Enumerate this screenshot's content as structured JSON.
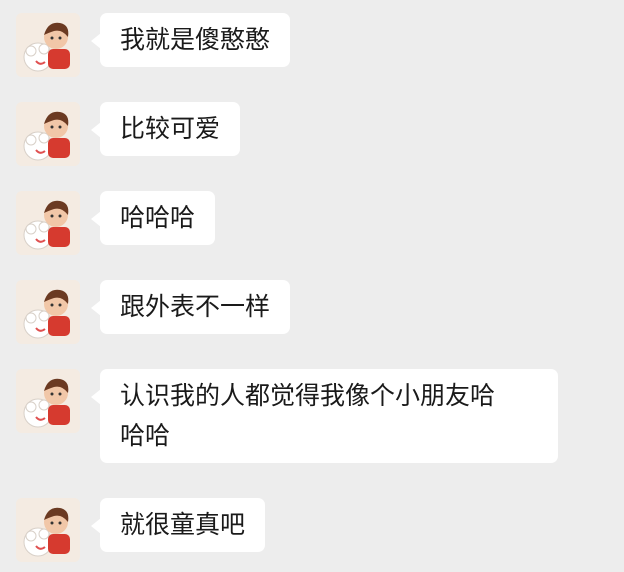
{
  "messages": [
    {
      "text": "我就是傻憨憨"
    },
    {
      "text": "比较可爱"
    },
    {
      "text": "哈哈哈"
    },
    {
      "text": "跟外表不一样"
    },
    {
      "text": "认识我的人都觉得我像个小朋友哈\n哈哈"
    },
    {
      "text": "就很童真吧"
    }
  ],
  "colors": {
    "background": "#ededed",
    "bubble": "#ffffff",
    "text": "#1a1a1a"
  },
  "icons": {
    "avatar": "cartoon-boy-with-cat-avatar"
  }
}
